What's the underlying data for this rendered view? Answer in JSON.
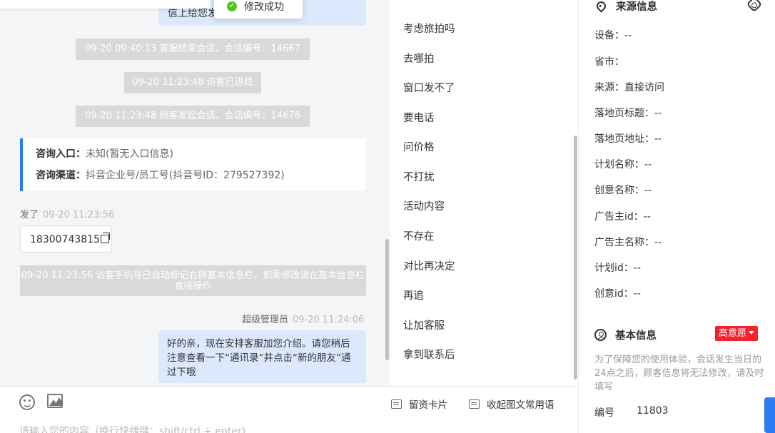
{
  "toast": {
    "text": "修改成功",
    "check": "✓"
  },
  "chat": {
    "top_bubble_text": "信上给您发",
    "system_messages": [
      "09-20 09:40:13 客服结束会话，会话编号：14667",
      "09-20 11:23:48 访客已进线",
      "09-20 11:23:48 顾客发起会话，会话编号：14676",
      "09-20 11:23:56 访客手机号已自动标记右侧基本信息栏，如需修改请在基本信息栏直接操作"
    ],
    "entry_card": {
      "entry_label": "咨询入口：",
      "entry_value": "未知(暂无入口信息)",
      "channel_label": "咨询渠道：",
      "channel_value": "抖音企业号/员工号(抖音号ID：279527392)"
    },
    "sent": {
      "label": "发了",
      "time": "09-20 11:23:56",
      "phone": "18300743815"
    },
    "admin": {
      "name": "超级管理员",
      "time": "09-20 11:24:06",
      "message": "好的亲，现在安排客服加您介绍。请您稍后注意查看一下“通讯录”并点击“新的朋友”通过下哦"
    }
  },
  "quick_replies": [
    "考虑旅拍吗",
    "去哪拍",
    "窗口发不了",
    "要电话",
    "问价格",
    "不打扰",
    "活动内容",
    "不存在",
    "对比再决定",
    "再追",
    "让加客服",
    "拿到联系后"
  ],
  "composer": {
    "card_button": "留资卡片",
    "collapse_button": "收起图文常用语",
    "placeholder": "请输入您的内容（换行快捷键：shift/ctrl + enter)"
  },
  "source_info": {
    "title": "来源信息",
    "fields": [
      {
        "label": "设备：",
        "value": "--"
      },
      {
        "label": "省市：",
        "value": ""
      },
      {
        "label": "来源：",
        "value": "直接访问"
      },
      {
        "label": "落地页标题：",
        "value": "--"
      },
      {
        "label": "落地页地址：",
        "value": "--"
      },
      {
        "label": "计划名称：",
        "value": "--"
      },
      {
        "label": "创意名称：",
        "value": "--"
      },
      {
        "label": "广告主id：",
        "value": "--"
      },
      {
        "label": "广告主名称：",
        "value": "--"
      },
      {
        "label": "计划id：",
        "value": "--"
      },
      {
        "label": "创意id：",
        "value": "--"
      }
    ]
  },
  "basic_info": {
    "title": "基本信息",
    "intent_badge": "高意愿",
    "notice": "为了保障您的使用体验，会话发生当日的24点之后，顾客信息将无法修改，请及时填写",
    "id_label": "编号",
    "id_value": "11803"
  },
  "colors": {
    "accent": "#2d7cf6",
    "badge": "#f5222d",
    "bubble": "#dce8fb",
    "success": "#52c41a"
  }
}
